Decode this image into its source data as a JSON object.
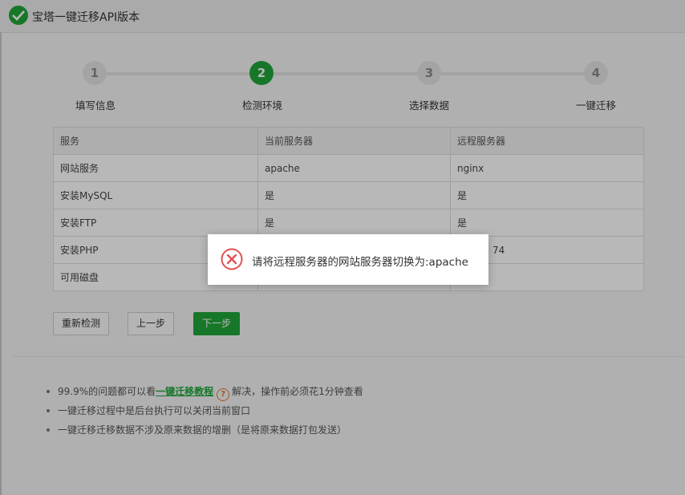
{
  "window": {
    "title": "宝塔一键迁移API版本",
    "icon": "check-icon"
  },
  "steps": [
    {
      "number": "1",
      "label": "填写信息"
    },
    {
      "number": "2",
      "label": "检测环境",
      "active": true
    },
    {
      "number": "3",
      "label": "选择数据"
    },
    {
      "number": "4",
      "label": "一键迁移"
    }
  ],
  "table": {
    "headers": [
      "服务",
      "当前服务器",
      "远程服务器"
    ],
    "rows": [
      [
        "网站服务",
        "apache",
        "nginx"
      ],
      [
        "安装MySQL",
        "是",
        "是"
      ],
      [
        "安装FTP",
        "是",
        "是"
      ],
      [
        "安装PHP",
        "",
        "74"
      ],
      [
        "可用磁盘",
        "",
        ""
      ]
    ]
  },
  "buttons": {
    "recheck": "重新检测",
    "prev": "上一步",
    "next": "下一步"
  },
  "tips": {
    "tip1_prefix": "99.9%的问题都可以看",
    "tip1_link": "一键迁移教程",
    "tip1_help": "?",
    "tip1_suffix": "解决，操作前必须花1分钟查看",
    "tip2": "一键迁移过程中是后台执行可以关闭当前窗口",
    "tip3": "一键迁移迁移数据不涉及原来数据的增删（是将原来数据打包发送）"
  },
  "toast": {
    "message": "请将远程服务器的网站服务器切换为:apache",
    "icon": "error-x-icon"
  },
  "colors": {
    "accent": "#20a53a",
    "error": "#e05050"
  }
}
